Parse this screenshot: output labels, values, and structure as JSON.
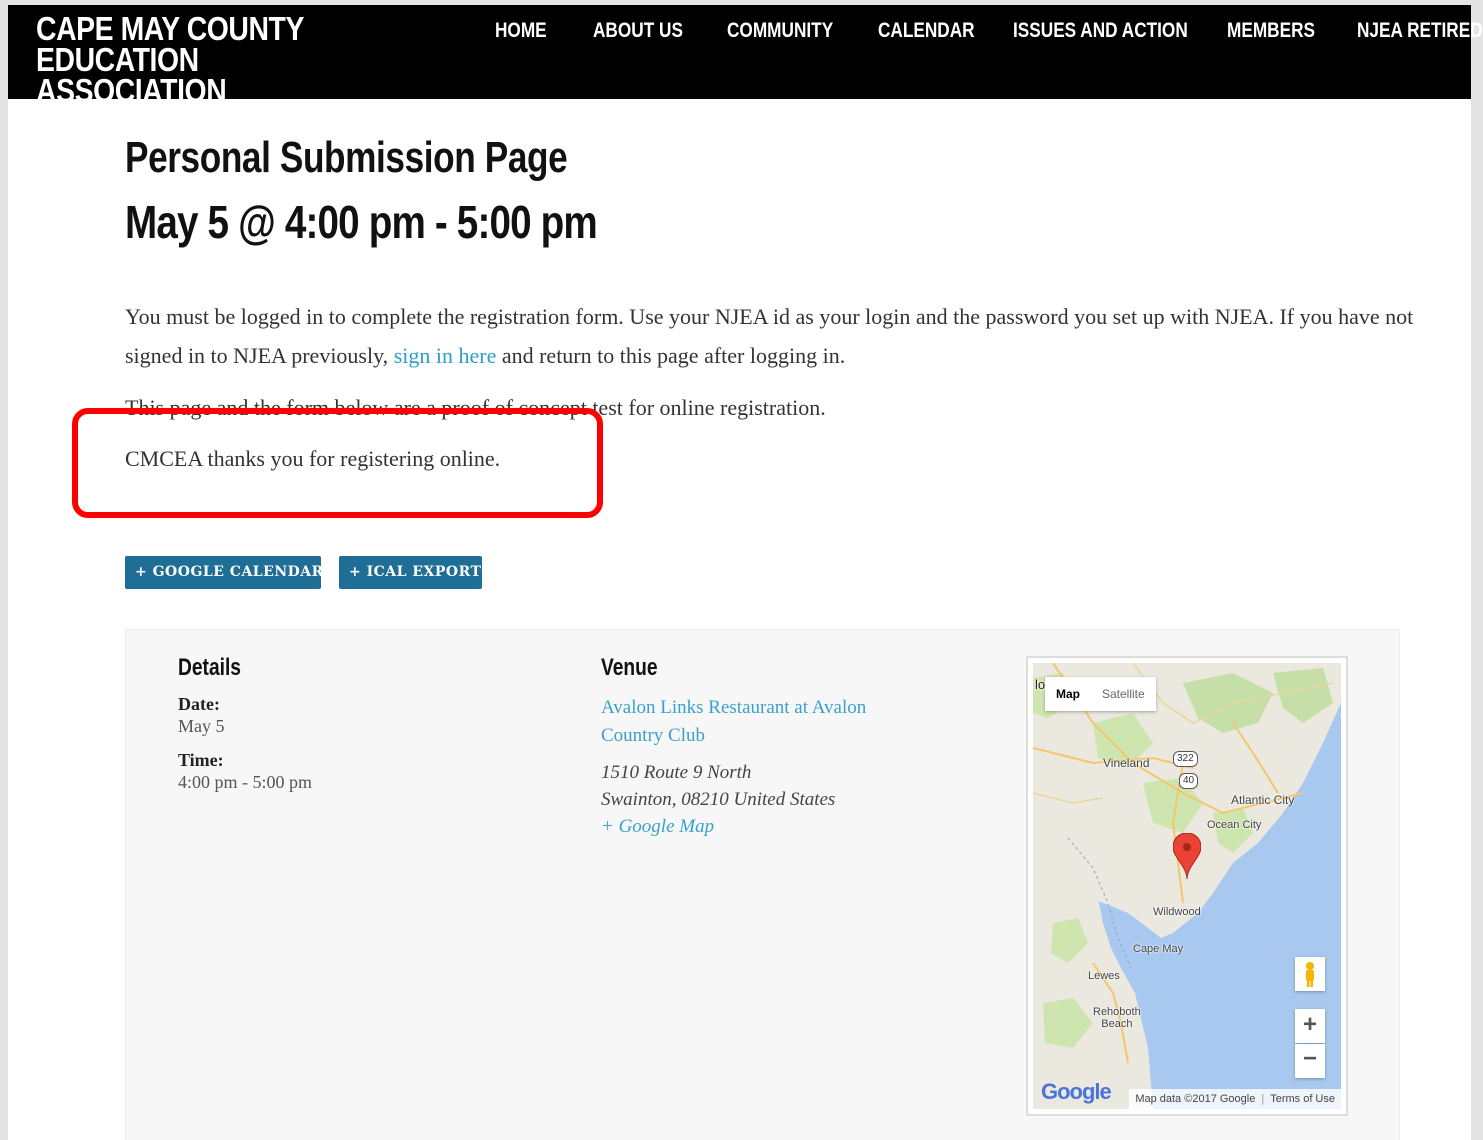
{
  "header": {
    "site_title": "CAPE MAY COUNTY EDUCATION\nASSOCIATION",
    "nav": [
      {
        "label": "HOME"
      },
      {
        "label": "ABOUT US"
      },
      {
        "label": "COMMUNITY"
      },
      {
        "label": "CALENDAR"
      },
      {
        "label": "ISSUES AND ACTION"
      },
      {
        "label": "MEMBERS"
      },
      {
        "label": "NJEA RETIRED"
      }
    ]
  },
  "event": {
    "title": "Personal Submission Page",
    "datetime": "May 5 @ 4:00 pm - 5:00 pm",
    "intro_before_link": "You must be logged in to complete the registration form. Use your NJEA id as your login and the password you set up with NJEA. If you have not signed in to NJEA previously, ",
    "intro_link": "sign in here",
    "intro_after_link": " and return to this page after logging in.",
    "proof_text": "This page and the form below are a proof of concept test for online registration.",
    "thanks_text": "CMCEA thanks you for registering online."
  },
  "buttons": {
    "google_calendar": "+ GOOGLE CALENDAR",
    "ical_export": "+ ICAL EXPORT"
  },
  "details": {
    "heading": "Details",
    "date_label": "Date:",
    "date_value": "May 5",
    "time_label": "Time:",
    "time_value": "4:00 pm - 5:00 pm"
  },
  "venue": {
    "heading": "Venue",
    "name": "Avalon Links Restaurant at Avalon Country Club",
    "address_line1": "1510 Route 9 North",
    "address_line2": "Swainton, 08210 United States",
    "map_link": "+ Google Map"
  },
  "map": {
    "type_map": "Map",
    "type_satellite": "Satellite",
    "places": {
      "vineland": "Vineland",
      "atlantic_city": "Atlantic City",
      "ocean_city": "Ocean City",
      "wildwood": "Wildwood",
      "cape_may": "Cape May",
      "lewes": "Lewes",
      "rehoboth": "Rehoboth\nBeach"
    },
    "routes": {
      "r322": "322",
      "r40": "40"
    },
    "zoom_in": "+",
    "zoom_out": "−",
    "logo": "Google",
    "map_data": "Map data ©2017 Google",
    "terms": "Terms of Use",
    "edge_text": "lo"
  }
}
